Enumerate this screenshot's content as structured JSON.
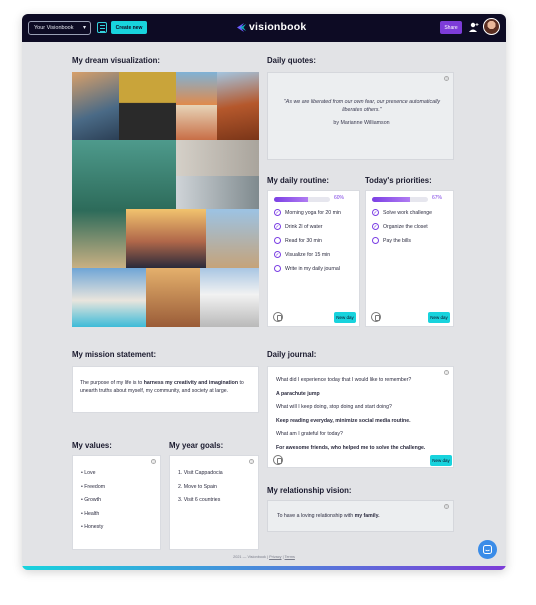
{
  "header": {
    "visionbook_select": "Your Visionbook",
    "create_new": "Create new",
    "logo_text": "visionbook",
    "share": "Share"
  },
  "dream": {
    "title": "My dream visualization:"
  },
  "quotes": {
    "title": "Daily quotes:",
    "text": "\"As we are liberated from our own fear, our presence automatically liberates others.\"",
    "author": "by Marianne Williamson"
  },
  "routine": {
    "title": "My daily routine:",
    "percent_label": "60%",
    "progress": 0.6,
    "tasks": [
      {
        "label": "Morning yoga for 20 min",
        "done": true
      },
      {
        "label": "Drink 2l of water",
        "done": true
      },
      {
        "label": "Read for 30 min",
        "done": false
      },
      {
        "label": "Visualize for 15 min",
        "done": true
      },
      {
        "label": "Write in my daily journal",
        "done": false
      }
    ],
    "new_day": "New day"
  },
  "priorities": {
    "title": "Today's priorities:",
    "percent_label": "67%",
    "progress": 0.67,
    "tasks": [
      {
        "label": "Solve work challenge",
        "done": true
      },
      {
        "label": "Organize the closet",
        "done": true
      },
      {
        "label": "Pay the bills",
        "done": false
      }
    ],
    "new_day": "New day"
  },
  "mission": {
    "title": "My mission statement:",
    "text_1": "The purpose of my life is to ",
    "text_bold": "harness my creativity and imagination",
    "text_2": " to unearth truths about myself, my community, and society at large."
  },
  "values": {
    "title": "My values:",
    "items": [
      "Love",
      "Freedom",
      "Growth",
      "Health",
      "Honesty"
    ]
  },
  "goals": {
    "title": "My year goals:",
    "items": [
      "1. Visit Cappadocia",
      "2. Move to Spain",
      "3. Visit 6 countries"
    ]
  },
  "journal": {
    "title": "Daily journal:",
    "lines": [
      {
        "text": "What did I experience today that I would like to remember?",
        "bold": false
      },
      {
        "text": "A parachute jump",
        "bold": true
      },
      {
        "text": "What will I keep doing, stop doing and start doing?",
        "bold": false
      },
      {
        "text": "Keep reading everyday, minimize social media routine.",
        "bold": true
      },
      {
        "text": "What am I grateful for today?",
        "bold": false
      },
      {
        "text": "For awesome friends, who helped me to solve the challenge.",
        "bold": true
      }
    ],
    "new_day": "New day"
  },
  "relationship": {
    "title": "My relationship vision:",
    "text_1": "To have a loving relationship with ",
    "text_bold": "my family."
  },
  "footer": {
    "text": "2021 — Visionbook | ",
    "privacy": "Privacy",
    "sep": " | ",
    "terms": "Terms"
  },
  "colors": {
    "accent_cyan": "#18d3dd",
    "accent_purple": "#7d3cd8",
    "topbar": "#0d0b24"
  }
}
